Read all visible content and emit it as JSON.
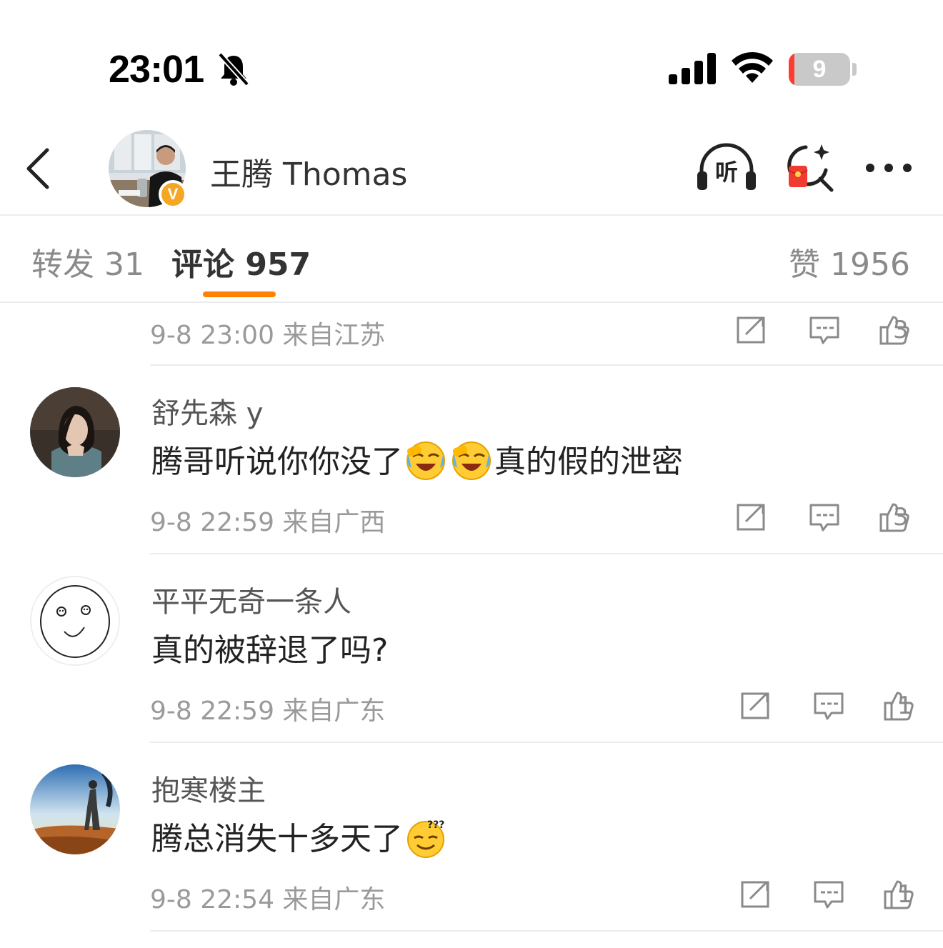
{
  "status_bar": {
    "time": "23:01",
    "battery_level": "9",
    "battery_fraction": 0.09
  },
  "header": {
    "title": "王腾 Thomas",
    "listen_label": "听",
    "verified_badge": "V",
    "icons": [
      "back-icon",
      "headphones-icon",
      "red-packet-search-icon",
      "more-icon"
    ]
  },
  "tabs": {
    "repost": "转发 31",
    "comments": "评论 957",
    "likes": "赞 1956",
    "active": "comments"
  },
  "colors": {
    "accent": "#ff8200",
    "verified": "#f5a623"
  },
  "top_partial": {
    "meta": "9-8 23:00  来自江苏",
    "likes": "3"
  },
  "comments": [
    {
      "name": "舒先森 y",
      "text_before": "腾哥听说你你没了",
      "emojis": [
        "crying-laughing-emoji",
        "crying-laughing-emoji"
      ],
      "text_after": "真的假的泄密",
      "meta": "9-8 22:59  来自广西",
      "likes": "3"
    },
    {
      "name": "平平无奇一条人",
      "text_before": "真的被辞退了吗?",
      "emojis": [],
      "text_after": "",
      "meta": "9-8 22:59  来自广东",
      "likes": "1"
    },
    {
      "name": "抱寒楼主",
      "text_before": "腾总消失十多天了",
      "emojis": [
        "confused-question-emoji"
      ],
      "text_after": "",
      "meta": "9-8 22:54  来自广东",
      "likes": "1"
    }
  ]
}
